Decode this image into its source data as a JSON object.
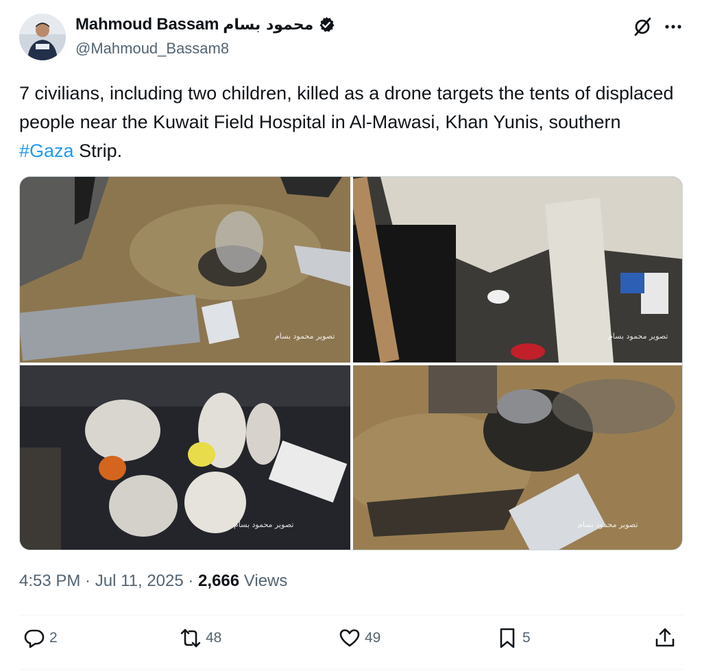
{
  "author": {
    "display_name": "Mahmoud Bassam",
    "arabic_name": "محمود بسام",
    "handle": "@Mahmoud_Bassam8",
    "verified": true
  },
  "header_icons": [
    "grok-icon",
    "more-icon"
  ],
  "tweet": {
    "text_before": "7 civilians, including two children, killed as a drone targets the tents of displaced people near the Kuwait Field Hospital in Al-Mawasi, Khan Yunis, southern ",
    "hashtag": "#Gaza",
    "text_after": " Strip."
  },
  "media": {
    "watermark": "تصوير محمود بسام"
  },
  "meta": {
    "time": "4:53 PM",
    "date": "Jul 11, 2025",
    "views_count": "2,666",
    "views_label": "Views"
  },
  "actions": {
    "replies": "2",
    "reposts": "48",
    "likes": "49",
    "bookmarks": "5"
  },
  "colors": {
    "accent": "#1d9bf0",
    "text_primary": "#0f1419",
    "text_secondary": "#536471",
    "divider": "#eff3f4"
  }
}
